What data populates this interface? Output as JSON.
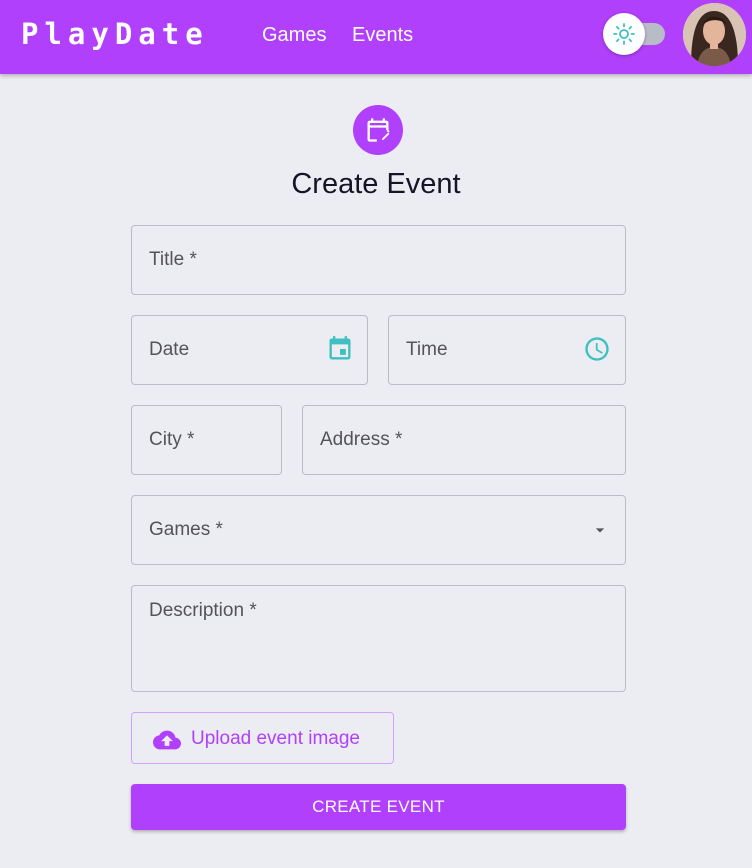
{
  "header": {
    "brand": "PlayDate",
    "nav": [
      {
        "label": "Games"
      },
      {
        "label": "Events"
      }
    ],
    "theme_toggle": {
      "icon": "sun-icon",
      "state": "off"
    },
    "avatar": {
      "icon": "user-avatar"
    }
  },
  "page": {
    "icon": "calendar-edit-icon",
    "title": "Create Event"
  },
  "form": {
    "title_label": "Title *",
    "date_label": "Date",
    "time_label": "Time",
    "city_label": "City *",
    "address_label": "Address *",
    "games_label": "Games *",
    "description_label": "Description *",
    "upload_label": "Upload event image",
    "submit_label": "CREATE EVENT"
  },
  "colors": {
    "primary": "#b040fb",
    "accent_icon": "#3fbfbf",
    "background": "#ecedf2"
  }
}
